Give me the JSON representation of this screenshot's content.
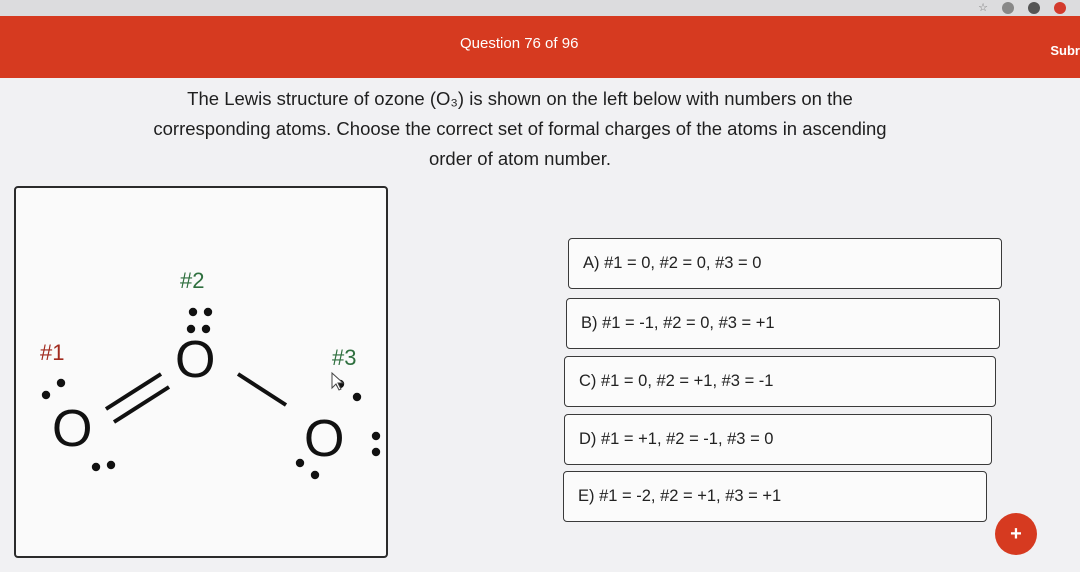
{
  "header": {
    "question_counter": "Question 76 of 96",
    "submit_label": "Subr"
  },
  "question": {
    "prompt": "The Lewis structure of ozone (O₃) is shown on the left below with numbers on the corresponding atoms. Choose the correct set of formal charges of the atoms in ascending order of atom number."
  },
  "structure": {
    "atom_symbol": "O",
    "labels": {
      "atom1": "#1",
      "atom2": "#2",
      "atom3": "#3"
    }
  },
  "choices": [
    {
      "label": "A) #1 = 0, #2 = 0, #3 = 0"
    },
    {
      "label": "B) #1 = -1, #2 = 0, #3 = +1"
    },
    {
      "label": "C) #1 = 0, #2 = +1, #3 = -1"
    },
    {
      "label": "D) #1 = +1, #2 = -1, #3 = 0"
    },
    {
      "label": "E) #1 = -2, #2 = +1, #3 = +1"
    }
  ],
  "fab": {
    "label": "+"
  },
  "colors": {
    "brand": "#d63a20",
    "label_green": "#2e6f3e",
    "label_red": "#a12a1e"
  },
  "icons": [
    "star-icon",
    "extension-icon",
    "puzzle-icon",
    "profile-icon"
  ]
}
